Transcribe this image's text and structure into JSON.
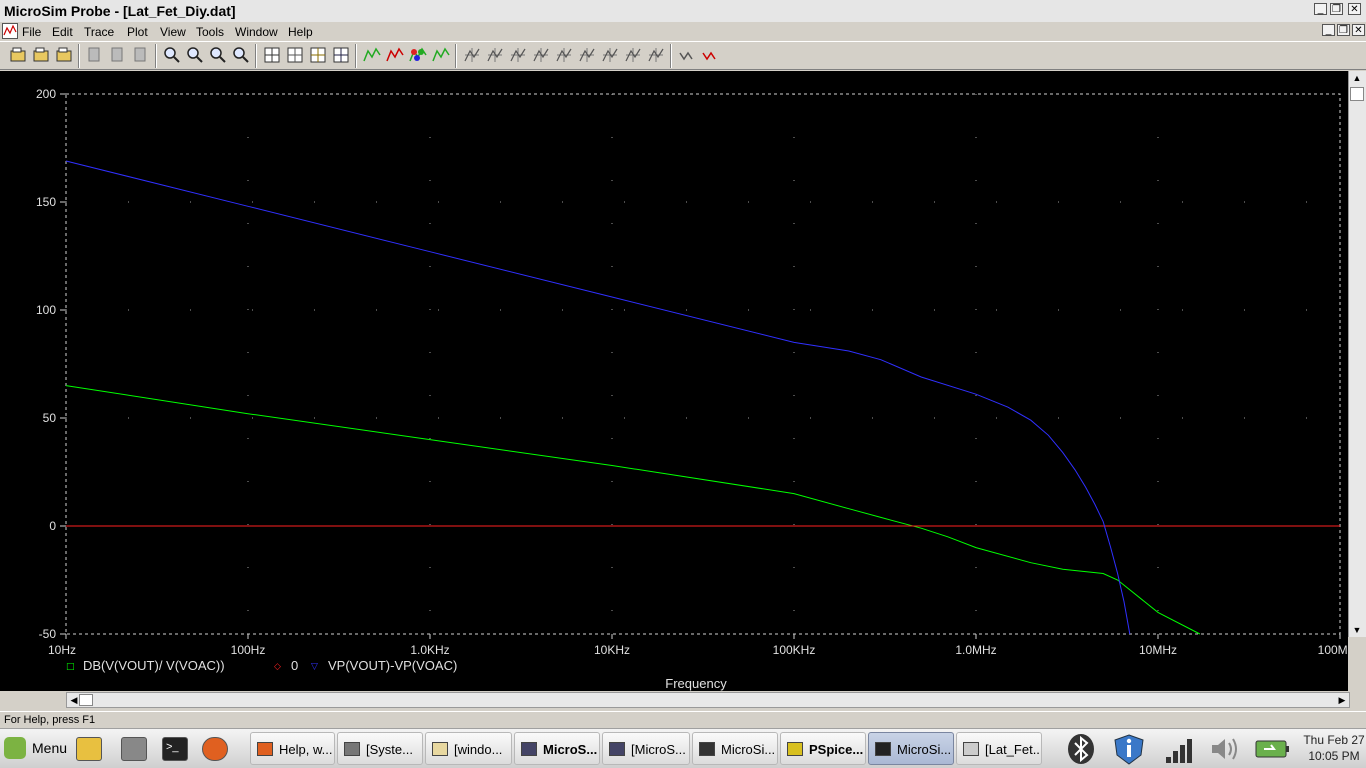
{
  "window": {
    "title": "MicroSim Probe - [Lat_Fet_Diy.dat]",
    "controls": [
      "_",
      "❐",
      "✕"
    ]
  },
  "menu": [
    "File",
    "Edit",
    "Trace",
    "Plot",
    "View",
    "Tools",
    "Window",
    "Help"
  ],
  "toolbar": {
    "groups": [
      [
        "open-icon",
        "append-icon",
        "print-icon"
      ],
      [
        "cut-icon",
        "copy-icon",
        "paste-icon"
      ],
      [
        "zoom-in-icon",
        "zoom-out-icon",
        "zoom-area-icon",
        "zoom-fit-icon"
      ],
      [
        "log-x-icon",
        "fourier-icon",
        "performance-icon",
        "eval-icon"
      ],
      [
        "add-trace-icon",
        "remove-trace-icon",
        "color-trace-icon",
        "cursor-icon"
      ],
      [
        "cursor-peak-icon",
        "cursor-trough-icon",
        "cursor-slope-icon",
        "cursor-min-icon",
        "cursor-max-icon",
        "cursor-point-icon",
        "cursor-search-icon",
        "cursor-next-icon",
        "cursor-label-icon"
      ],
      [
        "mark-label-icon",
        "toggle-cursor-icon"
      ]
    ]
  },
  "chart_data": {
    "type": "line",
    "xlabel": "Frequency",
    "x_scale": "log",
    "xlim": [
      10,
      100000000
    ],
    "x_ticks": [
      10,
      100,
      1000,
      10000,
      100000,
      1000000,
      10000000,
      100000000
    ],
    "x_tick_labels": [
      "10Hz",
      "100Hz",
      "1.0KHz",
      "10KHz",
      "100KHz",
      "1.0MHz",
      "10MHz",
      "100MHz"
    ],
    "ylim": [
      -50,
      200
    ],
    "y_ticks": [
      -50,
      0,
      50,
      100,
      150,
      200
    ],
    "y_tick_labels": [
      "-50",
      "0",
      "50",
      "100",
      "150",
      "200"
    ],
    "grid": "dotted",
    "legend_position": "bottom-left",
    "series": [
      {
        "name": "DB(V(VOUT)/ V(VOAC))",
        "color": "#00ff00",
        "marker": "□",
        "x": [
          10,
          100,
          1000,
          10000,
          100000,
          200000,
          300000,
          500000,
          700000,
          1000000,
          2000000,
          3000000,
          5000000,
          6000000,
          10000000,
          17000000
        ],
        "y": [
          65,
          52,
          40,
          28,
          15,
          8,
          4,
          -1,
          -5,
          -10,
          -17,
          -20,
          -22,
          -25,
          -40,
          -50
        ]
      },
      {
        "name": "0",
        "color": "#ff2020",
        "marker": "◇",
        "x": [
          10,
          100000000
        ],
        "y": [
          0,
          0
        ]
      },
      {
        "name": "VP(VOUT)-VP(VOAC)",
        "color": "#3030ff",
        "marker": "▽",
        "x": [
          10,
          100,
          1000,
          10000,
          100000,
          200000,
          300000,
          500000,
          1000000,
          1500000,
          2000000,
          2500000,
          3000000,
          3500000,
          4000000,
          4500000,
          5000000,
          5500000,
          6000000,
          6500000,
          7000000
        ],
        "y": [
          169,
          148,
          127,
          106,
          85,
          81,
          77,
          69,
          61,
          55,
          49,
          42,
          34,
          26,
          18,
          10,
          2,
          -10,
          -22,
          -35,
          -50
        ]
      }
    ]
  },
  "status": {
    "help_text": "For Help, press F1"
  },
  "taskbar": {
    "menu_label": "Menu",
    "launchers": [
      "files-icon",
      "drive-icon",
      "terminal-icon",
      "firefox-icon"
    ],
    "tasks": [
      {
        "label": "Help, w...",
        "icon": "firefox-icon",
        "bold": false,
        "active": false
      },
      {
        "label": "[Syste...",
        "icon": "monitor-icon",
        "bold": false,
        "active": false
      },
      {
        "label": "[windo...",
        "icon": "folder-icon",
        "bold": false,
        "active": false
      },
      {
        "label": "MicroS...",
        "icon": "microsim-icon",
        "bold": true,
        "active": false
      },
      {
        "label": "[MicroS...",
        "icon": "microsim-icon",
        "bold": false,
        "active": false
      },
      {
        "label": "MicroSi...",
        "icon": "editor-icon",
        "bold": false,
        "active": false
      },
      {
        "label": "PSpice...",
        "icon": "pspice-icon",
        "bold": true,
        "active": false
      },
      {
        "label": "MicroSi...",
        "icon": "probe-icon",
        "bold": false,
        "active": true
      },
      {
        "label": "[Lat_Fet...",
        "icon": "notepad-icon",
        "bold": false,
        "active": false
      }
    ],
    "tray": [
      "bluetooth-icon",
      "info-shield-icon",
      "network-signal-icon",
      "volume-icon",
      "battery-icon"
    ],
    "clock_day": "Thu Feb 27",
    "clock_time": "10:05 PM"
  }
}
